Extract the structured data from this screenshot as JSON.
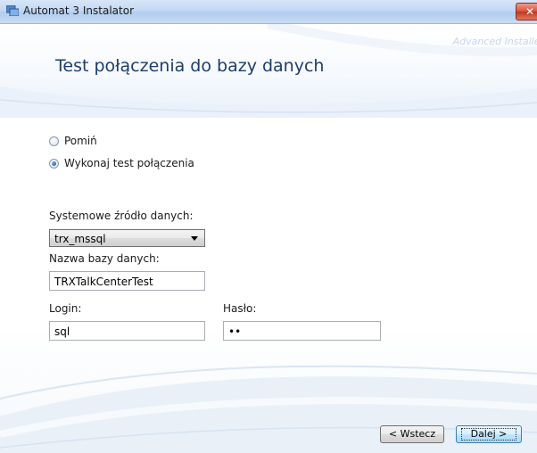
{
  "window": {
    "title": "Automat 3 Instalator",
    "close_glyph": "✕",
    "watermark": "Advanced Installer",
    "icon": "installer-app-icon"
  },
  "page": {
    "title": "Test połączenia do bazy danych"
  },
  "options": {
    "skip_label": "Pomiń",
    "test_label": "Wykonaj test połączenia",
    "selected": "test"
  },
  "form": {
    "dsn_label": "Systemowe źródło danych:",
    "dsn_value": "trx_mssql",
    "db_label": "Nazwa bazy danych:",
    "db_value": "TRXTalkCenterTest",
    "login_label": "Login:",
    "login_value": "sql",
    "password_label": "Hasło:",
    "password_value": "••"
  },
  "buttons": {
    "back_label": "< Wstecz",
    "next_label": "Dalej >"
  },
  "colors": {
    "title_text": "#1e3d6b",
    "accent": "#3c7fb1",
    "close": "#c2351f"
  }
}
